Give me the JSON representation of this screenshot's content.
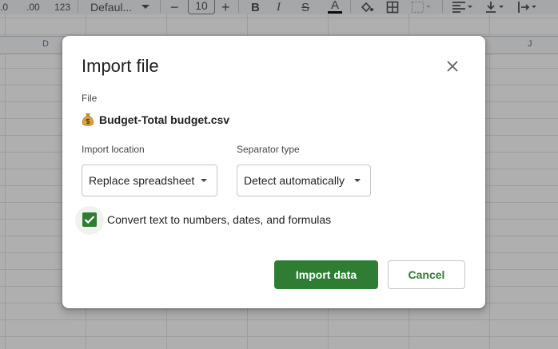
{
  "toolbar": {
    "decrease_decimal": ".0",
    "increase_decimal": ".00",
    "number_format": "123",
    "font_name": "Defaul...",
    "font_size": "10",
    "minus": "−",
    "plus": "+",
    "bold": "B",
    "italic": "I",
    "strikethrough": "S",
    "text_color": "A"
  },
  "sheet": {
    "column_headers": [
      "D",
      "J"
    ]
  },
  "dialog": {
    "title": "Import file",
    "file_label": "File",
    "file_name": "Budget-Total budget.csv",
    "file_icon": "money-bag-icon",
    "import_location_label": "Import location",
    "import_location_value": "Replace spreadsheet",
    "separator_type_label": "Separator type",
    "separator_type_value": "Detect automatically",
    "convert_checkbox_label": "Convert text to numbers, dates, and formulas",
    "convert_checked": true,
    "import_button": "Import data",
    "cancel_button": "Cancel"
  },
  "colors": {
    "accent": "#2e7d32",
    "overlay": "rgba(32,33,36,0.36)",
    "toolbar_bg": "#f1f3f4"
  }
}
